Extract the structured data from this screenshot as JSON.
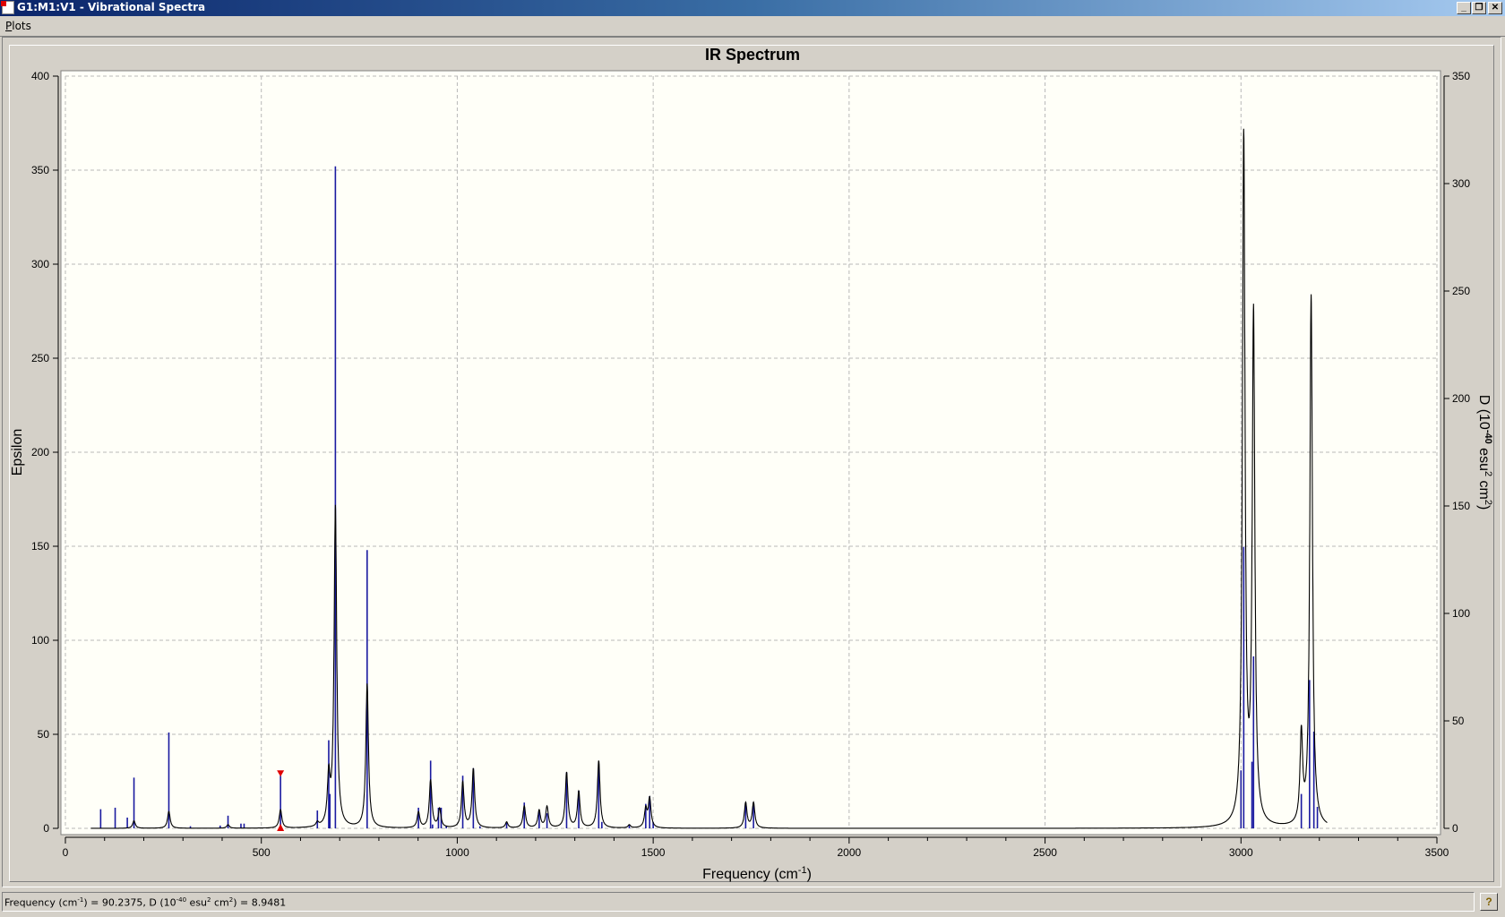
{
  "window": {
    "title": "G1:M1:V1 - Vibrational Spectra",
    "buttons": {
      "minimize": "_",
      "restore": "❐",
      "close": "✕"
    }
  },
  "menu": {
    "items": [
      {
        "label": "Plots"
      }
    ]
  },
  "status": {
    "prefix": "Frequency (cm",
    "exp1": "-1",
    "mid": ") = 90.2375, D (10",
    "exp2": "-40",
    "mid2": " esu",
    "exp3": "2",
    "mid3": " cm",
    "exp4": "2",
    "suffix": ") = 8.9481",
    "help_label": "?"
  },
  "chart_data": {
    "type": "line",
    "title": "IR Spectrum",
    "xlabel": "Frequency (cm-1)",
    "xlabel_main": "Frequency (cm",
    "xlabel_sup": "-1",
    "xlabel_end": ")",
    "ylabel": "Epsilon",
    "y2label_main": "D (10",
    "y2label_sup1": "-40",
    "y2label_mid": " esu",
    "y2label_sup2": "2",
    "y2label_mid2": " cm",
    "y2label_sup3": "2",
    "y2label_end": ")",
    "xlim": [
      0,
      3500
    ],
    "ylim": [
      0,
      400
    ],
    "y2lim": [
      0,
      350
    ],
    "xticks": [
      0,
      500,
      1000,
      1500,
      2000,
      2500,
      3000,
      3500
    ],
    "yticks": [
      0,
      50,
      100,
      150,
      200,
      250,
      300,
      350,
      400
    ],
    "y2ticks": [
      0,
      50,
      100,
      150,
      200,
      250,
      300,
      350
    ],
    "grid": true,
    "colors": {
      "spectrum": "#000000",
      "sticks": "#1a1aa0",
      "marker": "#e00000",
      "background": "#fffff8"
    },
    "spectrum_range": [
      65,
      3220
    ],
    "spectrum_peaks": [
      [
        175,
        4
      ],
      [
        264,
        9
      ],
      [
        415,
        2
      ],
      [
        549,
        10
      ],
      [
        643,
        4
      ],
      [
        672,
        34
      ],
      [
        689,
        172
      ],
      [
        770,
        77
      ],
      [
        901,
        9
      ],
      [
        932,
        26
      ],
      [
        955,
        11
      ],
      [
        1014,
        25
      ],
      [
        1041,
        32
      ],
      [
        1126,
        3.5
      ],
      [
        1171,
        12
      ],
      [
        1209,
        10
      ],
      [
        1229,
        12
      ],
      [
        1279,
        30
      ],
      [
        1310,
        20
      ],
      [
        1361,
        36
      ],
      [
        1439,
        2
      ],
      [
        1481,
        12
      ],
      [
        1491,
        17
      ],
      [
        1736,
        14
      ],
      [
        1756,
        14
      ],
      [
        3007,
        372
      ],
      [
        3032,
        279
      ],
      [
        3154,
        55
      ],
      [
        3179,
        284
      ]
    ],
    "sticks_D": [
      [
        90,
        8.9
      ],
      [
        127,
        9.6
      ],
      [
        158,
        5
      ],
      [
        175,
        23.6
      ],
      [
        264,
        44.6
      ],
      [
        319,
        1
      ],
      [
        395,
        1.3
      ],
      [
        415,
        5.9
      ],
      [
        448,
        2.2
      ],
      [
        456,
        2.2
      ],
      [
        549,
        24.5
      ],
      [
        643,
        8.3
      ],
      [
        672,
        41
      ],
      [
        675,
        16
      ],
      [
        689,
        308
      ],
      [
        770,
        129.5
      ],
      [
        901,
        9.6
      ],
      [
        932,
        31.5
      ],
      [
        937,
        1.8
      ],
      [
        952,
        9.6
      ],
      [
        959,
        9.6
      ],
      [
        972,
        1.3
      ],
      [
        1014,
        24.5
      ],
      [
        1041,
        28
      ],
      [
        1058,
        1
      ],
      [
        1126,
        2.6
      ],
      [
        1171,
        12
      ],
      [
        1209,
        8.3
      ],
      [
        1229,
        7
      ],
      [
        1279,
        26
      ],
      [
        1310,
        17.5
      ],
      [
        1361,
        30
      ],
      [
        1369,
        3
      ],
      [
        1439,
        1.8
      ],
      [
        1481,
        11.4
      ],
      [
        1491,
        15
      ],
      [
        1500,
        3
      ],
      [
        1736,
        12
      ],
      [
        1756,
        12
      ],
      [
        3000,
        27
      ],
      [
        3007,
        131
      ],
      [
        3028,
        31
      ],
      [
        3032,
        80
      ],
      [
        3154,
        16
      ],
      [
        3175,
        69
      ],
      [
        3186,
        45
      ],
      [
        3195,
        10
      ]
    ],
    "selected_mode": {
      "frequency": 549
    }
  }
}
